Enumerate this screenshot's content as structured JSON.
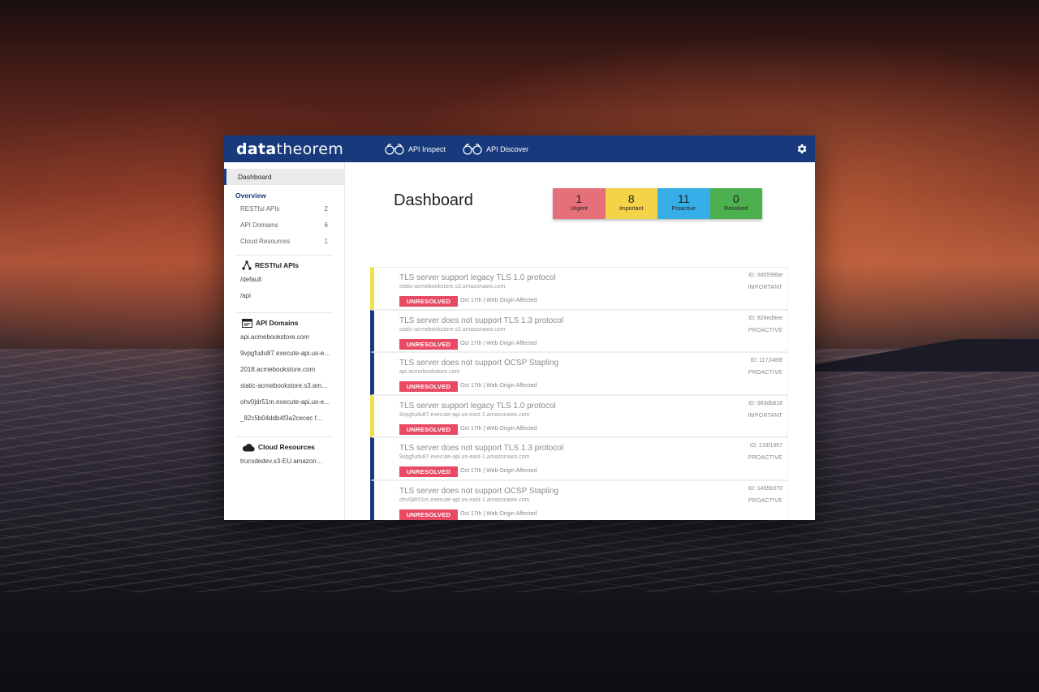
{
  "app": {
    "logo_prefix": "data",
    "logo_suffix": "theorem",
    "nav": [
      {
        "label": "API Inspect",
        "icon": "binoculars-icon"
      },
      {
        "label": "API Discover",
        "icon": "binoculars-icon"
      }
    ],
    "settings_icon": "gear-icon"
  },
  "sidebar": {
    "dashboard_label": "Dashboard",
    "overview_label": "Overview",
    "overview_items": [
      {
        "label": "RESTful APIs",
        "count": "2"
      },
      {
        "label": "API Domains",
        "count": "6"
      },
      {
        "label": "Cloud Resources",
        "count": "1"
      }
    ],
    "restful": {
      "heading": "RESTful APIs",
      "items": [
        "/default",
        "/api"
      ]
    },
    "domains": {
      "heading": "API Domains",
      "items": [
        "api.acmebookstore.com",
        "9vpgfudu87.execute-api.us-e…",
        "2018.acmebookstore.com",
        "static-acmebookstore.s3.am…",
        "ohv0jdr51m.execute-api.us-e…",
        "_82c5b04ddb4f3a2cecec f…"
      ]
    },
    "cloud": {
      "heading": "Cloud Resources",
      "items": [
        "trucsdedev.s3-EU.amazon…"
      ]
    }
  },
  "main": {
    "title": "Dashboard",
    "stats": [
      {
        "count": "1",
        "label": "Urgent",
        "color": "#e5707a"
      },
      {
        "count": "8",
        "label": "Important",
        "color": "#f5d349"
      },
      {
        "count": "11",
        "label": "Proactive",
        "color": "#36aee8"
      },
      {
        "count": "0",
        "label": "Resolved",
        "color": "#4db04e"
      }
    ],
    "issues": [
      {
        "title": "TLS server support legacy TLS 1.0 protocol",
        "host": "static-acmebookstore.s3.amazonaws.com",
        "status": "UNRESOLVED",
        "meta": "Oct 17th | Web Origin Affected",
        "id": "ID: 9d0599be",
        "severity": "IMPORTANT",
        "accent": "#f2df4a"
      },
      {
        "title": "TLS server does not support TLS 1.3 protocol",
        "host": "static-acmebookstore.s3.amazonaws.com",
        "status": "UNRESOLVED",
        "meta": "Oct 17th | Web Origin Affected",
        "id": "ID: 828ed9ee",
        "severity": "PROACTIVE",
        "accent": "#183a7c"
      },
      {
        "title": "TLS server does not support OCSP Stapling",
        "host": "api.acmebookstore.com",
        "status": "UNRESOLVED",
        "meta": "Oct 17th | Web Origin Affected",
        "id": "ID: 1172489f",
        "severity": "PROACTIVE",
        "accent": "#183a7c"
      },
      {
        "title": "TLS server support legacy TLS 1.0 protocol",
        "host": "9vpgfudu87.execute-api.us-east-1.amazonaws.com",
        "status": "UNRESOLVED",
        "meta": "Oct 17th | Web Origin Affected",
        "id": "ID: 983db818",
        "severity": "IMPORTANT",
        "accent": "#f2df4a"
      },
      {
        "title": "TLS server does not support TLS 1.3 protocol",
        "host": "9vpgfudu87.execute-api.us-east-1.amazonaws.com",
        "status": "UNRESOLVED",
        "meta": "Oct 17th | Web Origin Affected",
        "id": "ID: 133f1967",
        "severity": "PROACTIVE",
        "accent": "#183a7c"
      },
      {
        "title": "TLS server does not support OCSP Stapling",
        "host": "ohv0jdr51m.execute-api.us-east-1.amazonaws.com",
        "status": "UNRESOLVED",
        "meta": "Oct 17th | Web Origin Affected",
        "id": "ID: 1495b370",
        "severity": "PROACTIVE",
        "accent": "#183a7c"
      }
    ]
  }
}
